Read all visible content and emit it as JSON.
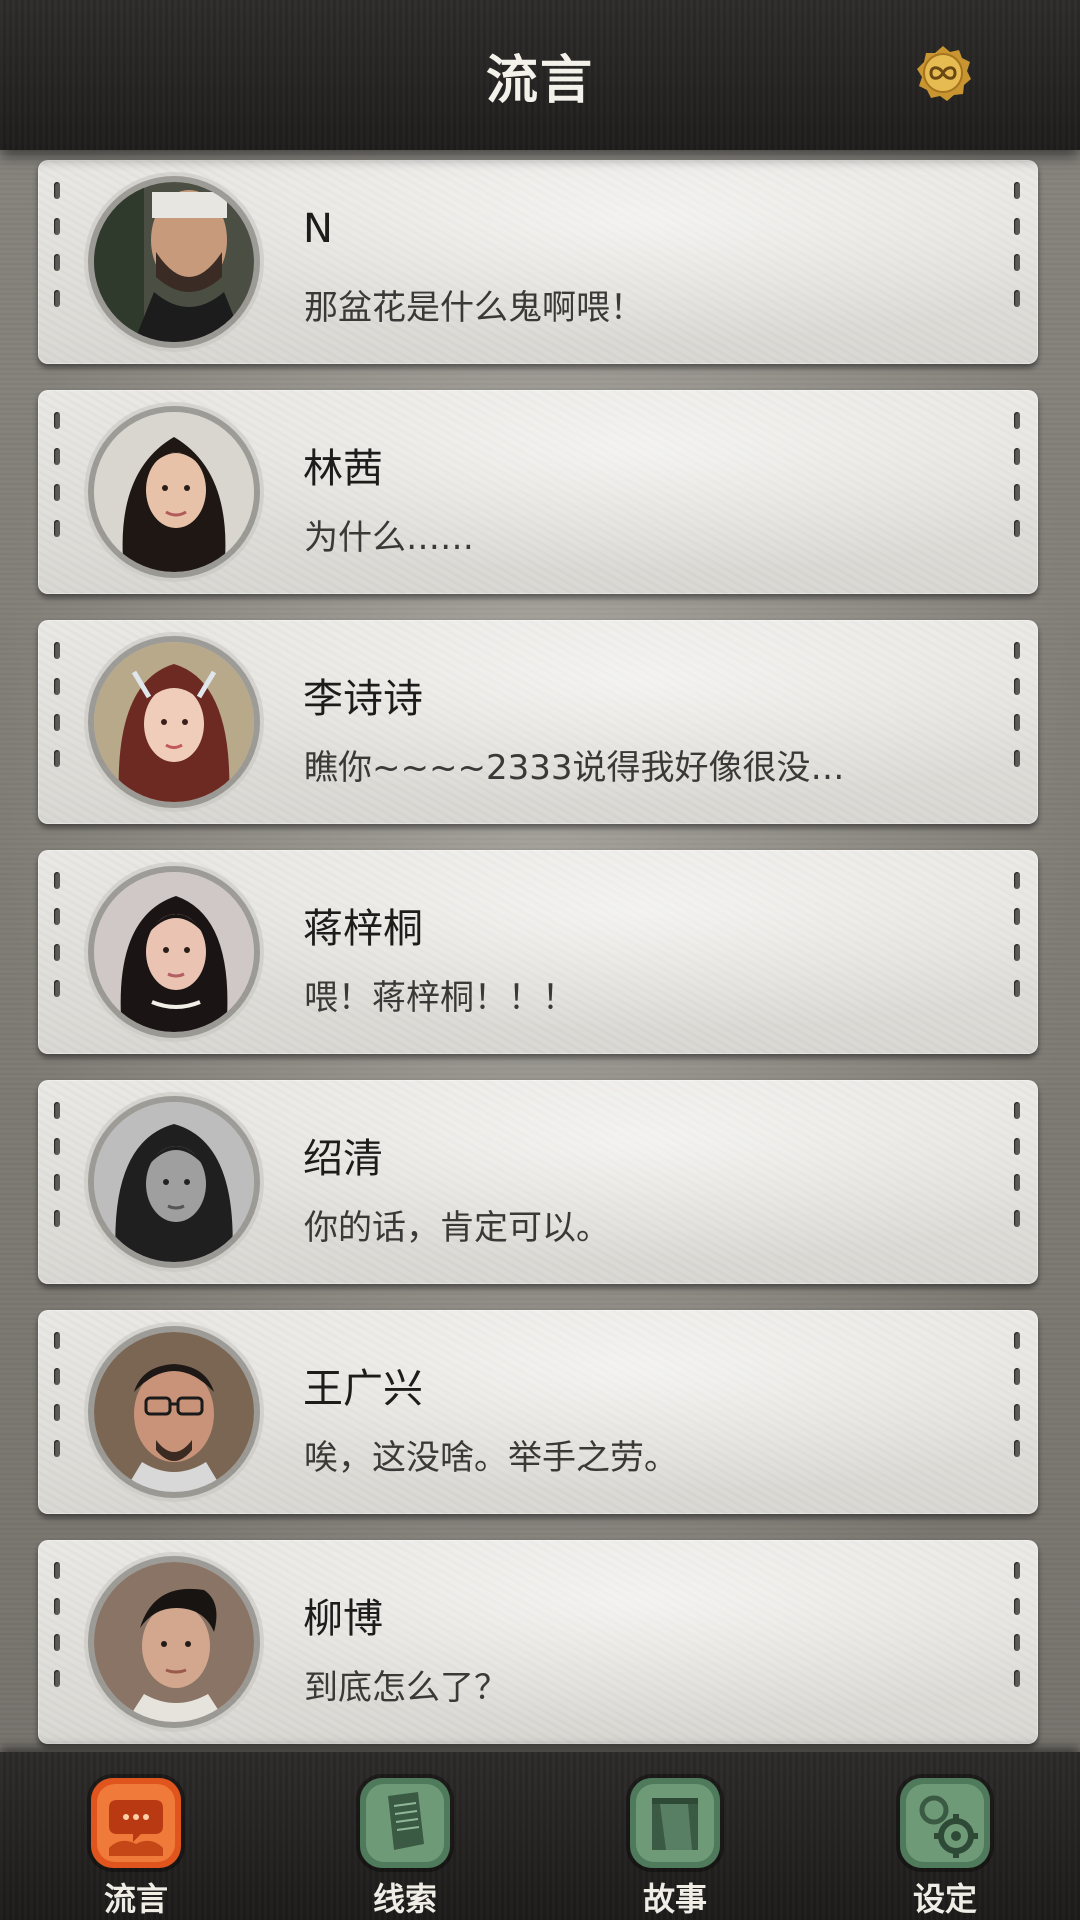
{
  "header": {
    "title": "流言",
    "badge_icon": "infinity-coin-icon",
    "badge_color": "#d8a83a"
  },
  "conversations": [
    {
      "name": "N",
      "message": "那盆花是什么鬼啊喂！",
      "avatar": "man-beard-avatar"
    },
    {
      "name": "林茜",
      "message": "为什么……",
      "avatar": "woman-long-hair-avatar"
    },
    {
      "name": "李诗诗",
      "message": "瞧你~~~~2333说得我好像很没…",
      "avatar": "woman-red-hair-avatar"
    },
    {
      "name": "蒋梓桐",
      "message": "喂！蒋梓桐！！！",
      "avatar": "woman-dark-hair-avatar"
    },
    {
      "name": "绍清",
      "message": "你的话，肯定可以。",
      "avatar": "woman-monochrome-avatar"
    },
    {
      "name": "王广兴",
      "message": "唉，这没啥。举手之劳。",
      "avatar": "man-glasses-avatar"
    },
    {
      "name": "柳博",
      "message": "到底怎么了？",
      "avatar": "man-young-avatar"
    }
  ],
  "tabs": [
    {
      "label": "流言",
      "icon": "chat-bubble-icon",
      "active": true,
      "color": "#e0551e"
    },
    {
      "label": "线索",
      "icon": "document-icon",
      "active": false,
      "color": "#5d8e6a"
    },
    {
      "label": "故事",
      "icon": "book-icon",
      "active": false,
      "color": "#5d8e6a"
    },
    {
      "label": "设定",
      "icon": "gear-icon",
      "active": false,
      "color": "#5d8e6a"
    }
  ]
}
